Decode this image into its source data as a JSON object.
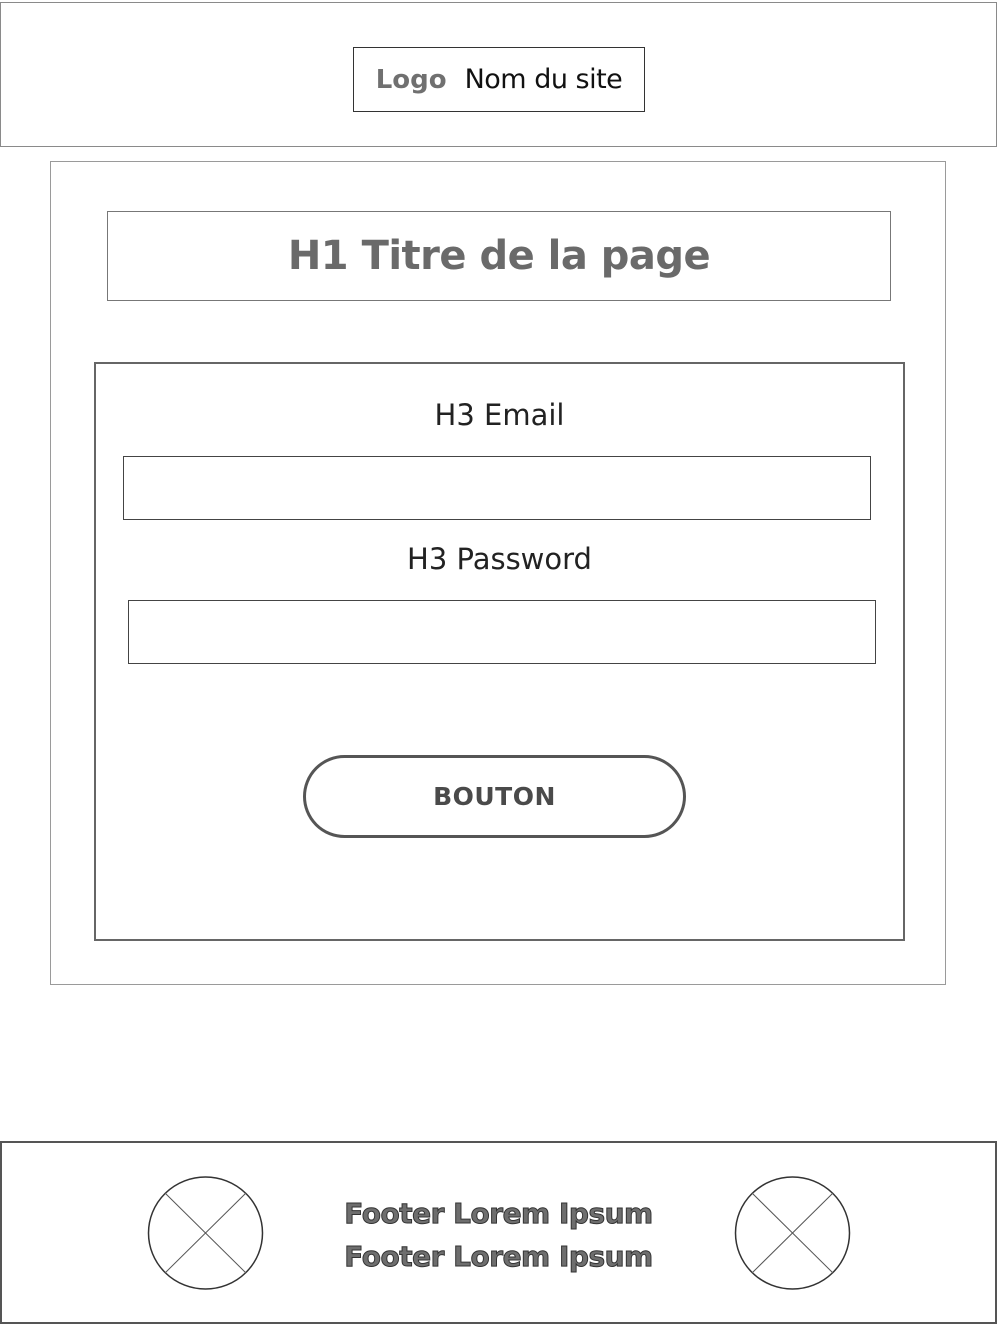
{
  "header": {
    "logo_text": "Logo",
    "site_name": "Nom du site"
  },
  "main": {
    "title": "H1 Titre de la page"
  },
  "form": {
    "email_label": "H3 Email",
    "email_value": "",
    "password_label": "H3 Password",
    "password_value": "",
    "button_label": "BOUTON"
  },
  "footer": {
    "lines": [
      "Footer Lorem Ipsum",
      "Footer Lorem Ipsum"
    ],
    "left_image_icon": "image-placeholder-icon",
    "right_image_icon": "image-placeholder-icon"
  },
  "colors": {
    "title_gray": "#6a6a6a",
    "border_dark": "#555555"
  }
}
